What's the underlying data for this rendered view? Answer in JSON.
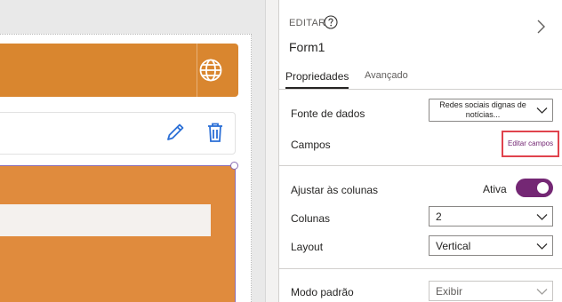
{
  "panel": {
    "edit_label": "EDITAR",
    "form_name": "Form1",
    "tabs": [
      {
        "label": "Propriedades",
        "active": true
      },
      {
        "label": "Avançado",
        "active": false
      }
    ],
    "data_source": {
      "label": "Fonte de dados",
      "value": "Redes sociais dignas de notícias..."
    },
    "fields": {
      "label": "Campos",
      "button": "Editar campos"
    },
    "snap_to_columns": {
      "label": "Ajustar às colunas",
      "state_label": "Ativa",
      "on": true
    },
    "columns": {
      "label": "Colunas",
      "value": "2"
    },
    "layout": {
      "label": "Layout",
      "value": "Vertical"
    },
    "default_mode": {
      "label": "Modo padrão",
      "value": "Exibir"
    }
  },
  "colors": {
    "accent": "#742774",
    "header_orange": "#d9862f",
    "form_orange": "#e08b3d",
    "highlight_red": "#e0434d"
  },
  "icons": [
    "globe-icon",
    "pencil-icon",
    "trash-icon",
    "help-icon",
    "chevron-right-icon",
    "chevron-down-icon"
  ]
}
